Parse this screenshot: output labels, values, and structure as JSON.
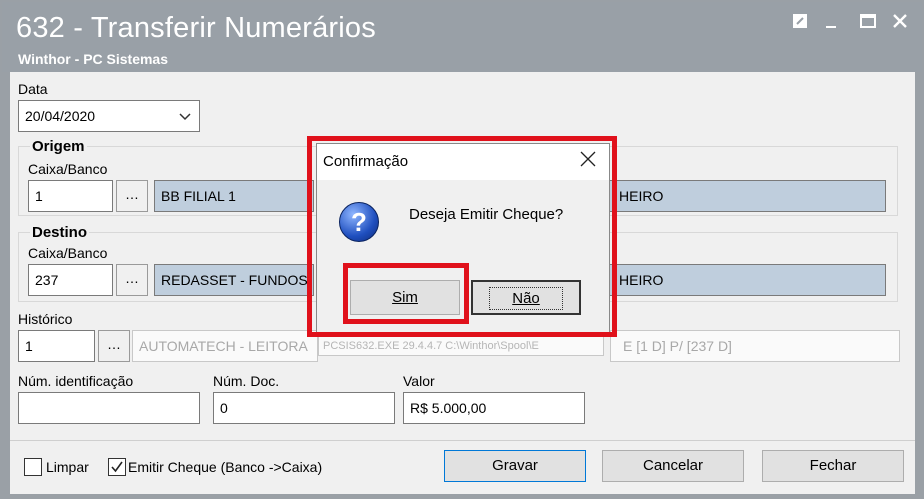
{
  "window": {
    "title": "632 - Transferir Numerários",
    "subtitle": "Winthor - PC Sistemas"
  },
  "form": {
    "data_label": "Data",
    "data_value": "20/04/2020",
    "origem": {
      "group_label": "Origem",
      "caixa_label": "Caixa/Banco",
      "code": "1",
      "name": "BB FILIAL 1",
      "moeda_partial": "HEIRO"
    },
    "destino": {
      "group_label": "Destino",
      "caixa_label": "Caixa/Banco",
      "code": "237",
      "name": "REDASSET - FUNDOS",
      "moeda_partial": "HEIRO"
    },
    "historico_label": "Histórico",
    "historico_code": "1",
    "historico_desc": "AUTOMATECH - LEITORA",
    "historico_desc_right": "E [1 D] P/ [237 D]",
    "status_tip": "PCSIS632.EXE 29.4.4.7 C:\\Winthor\\Spool\\E",
    "num_ident_label": "Núm. identificação",
    "num_ident_value": "",
    "num_doc_label": "Núm. Doc.",
    "num_doc_value": "0",
    "valor_label": "Valor",
    "valor_value": "R$ 5.000,00"
  },
  "bottom": {
    "limpar_label": "Limpar",
    "limpar_checked": false,
    "emitir_label": "Emitir Cheque (Banco ->Caixa)",
    "emitir_checked": true,
    "gravar": "Gravar",
    "cancelar": "Cancelar",
    "fechar": "Fechar"
  },
  "dialog": {
    "title": "Confirmação",
    "message": "Deseja Emitir Cheque?",
    "icon": "question-icon",
    "sim": "Sim",
    "nao": "Não"
  },
  "colors": {
    "titlebar": "#99a0a7",
    "highlight": "#e0111b",
    "readonly_field": "#bfcedd"
  }
}
